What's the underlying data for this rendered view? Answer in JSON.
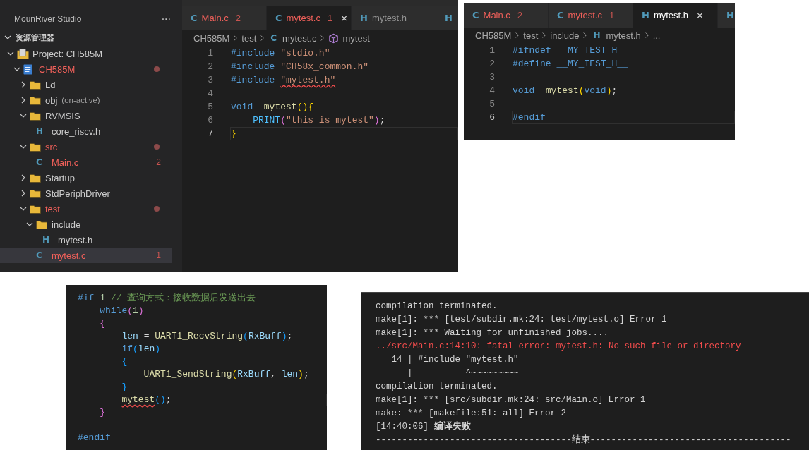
{
  "ide": {
    "sidebar": {
      "title": "MounRiver Studio",
      "more": "···",
      "section": "资源管理器",
      "tree": [
        {
          "label": "Project: CH585M",
          "kind": "project",
          "expanded": true,
          "error": false,
          "selected": false,
          "children": [
            {
              "label": "CH585M",
              "kind": "package",
              "expanded": true,
              "error": true,
              "dot": true,
              "selected": false,
              "children": [
                {
                  "label": "Ld",
                  "kind": "folder",
                  "expanded": false,
                  "error": false,
                  "selected": false
                },
                {
                  "label": "obj",
                  "note": "(on-active)",
                  "kind": "folder",
                  "expanded": false,
                  "error": false,
                  "selected": false
                },
                {
                  "label": "RVMSIS",
                  "kind": "folder",
                  "expanded": true,
                  "error": false,
                  "selected": false,
                  "children": [
                    {
                      "label": "core_riscv.h",
                      "kind": "file",
                      "letter": "H",
                      "error": false,
                      "selected": false
                    }
                  ]
                },
                {
                  "label": "src",
                  "kind": "folder",
                  "expanded": true,
                  "error": true,
                  "dot": true,
                  "selected": false,
                  "children": [
                    {
                      "label": "Main.c",
                      "kind": "file",
                      "letter": "C",
                      "badge": "2",
                      "error": true,
                      "selected": false
                    }
                  ]
                },
                {
                  "label": "Startup",
                  "kind": "folder",
                  "expanded": false,
                  "error": false,
                  "selected": false
                },
                {
                  "label": "StdPeriphDriver",
                  "kind": "folder",
                  "expanded": false,
                  "error": false,
                  "selected": false
                },
                {
                  "label": "test",
                  "kind": "folder",
                  "expanded": true,
                  "error": true,
                  "dot": true,
                  "selected": false,
                  "children": [
                    {
                      "label": "include",
                      "kind": "folder",
                      "expanded": true,
                      "error": false,
                      "selected": false,
                      "children": [
                        {
                          "label": "mytest.h",
                          "kind": "file",
                          "letter": "H",
                          "error": false,
                          "selected": false
                        }
                      ]
                    },
                    {
                      "label": "mytest.c",
                      "kind": "file",
                      "letter": "C",
                      "badge": "1",
                      "error": true,
                      "selected": true
                    }
                  ]
                }
              ]
            }
          ]
        }
      ]
    },
    "editor": {
      "tabs": [
        {
          "letter": "C",
          "label": "Main.c",
          "badge": "2",
          "error": true,
          "selected": false
        },
        {
          "letter": "C",
          "label": "mytest.c",
          "badge": "1",
          "error": true,
          "close": "×",
          "selected": true
        },
        {
          "letter": "H",
          "label": "mytest.h",
          "error": false,
          "selected": false
        },
        {
          "letter": "H",
          "selected": false
        }
      ],
      "breadcrumb": [
        {
          "text": "CH585M"
        },
        {
          "text": "test"
        },
        {
          "letter": "C",
          "text": "mytest.c"
        },
        {
          "kind": "symbol",
          "text": "mytest"
        }
      ],
      "lines": [
        {
          "number": "1",
          "current": false,
          "tokens": [
            {
              "t": "#include",
              "kind": "kw"
            },
            {
              "t": " \"stdio.h\"",
              "kind": "str"
            }
          ]
        },
        {
          "number": "2",
          "current": false,
          "tokens": [
            {
              "t": "#include",
              "kind": "kw"
            },
            {
              "t": " \"CH58x_common.h\"",
              "kind": "str"
            }
          ]
        },
        {
          "number": "3",
          "current": false,
          "tokens": [
            {
              "t": "#include",
              "kind": "kw"
            },
            {
              "t": " \"mytest.h\"",
              "kind": "str",
              "squiggle": true
            }
          ]
        },
        {
          "number": "4",
          "current": false
        },
        {
          "number": "5",
          "current": false,
          "tokens": [
            {
              "t": "void",
              "kind": "kw"
            },
            {
              "t": "  mytest",
              "kind": "fn"
            },
            {
              "t": "(){",
              "kind": "br1"
            }
          ]
        },
        {
          "number": "6",
          "current": false,
          "tokens": [
            {
              "t": "    PRINT",
              "kind": "macro"
            },
            {
              "t": "(",
              "kind": "br2"
            },
            {
              "t": "\"this is mytest\"",
              "kind": "str"
            },
            {
              "t": ")",
              "kind": "br2"
            },
            {
              "t": ";",
              "kind": "plain"
            }
          ]
        },
        {
          "number": "7",
          "current": true,
          "tokens": [
            {
              "t": "}",
              "kind": "br1"
            }
          ]
        }
      ]
    }
  },
  "header_window": {
    "editor": {
      "tabs": [
        {
          "letter": "C",
          "label": "Main.c",
          "badge": "2",
          "error": true,
          "selected": false
        },
        {
          "letter": "C",
          "label": "mytest.c",
          "badge": "1",
          "error": true,
          "selected": false
        },
        {
          "letter": "H",
          "label": "mytest.h",
          "error": false,
          "close": "×",
          "selected": true
        },
        {
          "letter": "H",
          "selected": false
        }
      ],
      "breadcrumb": [
        {
          "text": "CH585M"
        },
        {
          "text": "test"
        },
        {
          "text": "include"
        },
        {
          "letter": "H",
          "text": "mytest.h"
        },
        {
          "text": "..."
        }
      ],
      "lines": [
        {
          "number": "1",
          "current": false,
          "tokens": [
            {
              "t": "#ifndef",
              "kind": "kw"
            },
            {
              "t": " __MY_TEST_H__",
              "kind": "kw"
            }
          ]
        },
        {
          "number": "2",
          "current": false,
          "tokens": [
            {
              "t": "#define",
              "kind": "kw"
            },
            {
              "t": " __MY_TEST_H__",
              "kind": "kw"
            }
          ]
        },
        {
          "number": "3",
          "current": false
        },
        {
          "number": "4",
          "current": false,
          "tokens": [
            {
              "t": "void",
              "kind": "kw"
            },
            {
              "t": "  mytest",
              "kind": "fn"
            },
            {
              "t": "(",
              "kind": "br1"
            },
            {
              "t": "void",
              "kind": "kw"
            },
            {
              "t": ")",
              "kind": "br1"
            },
            {
              "t": ";",
              "kind": "plain"
            }
          ]
        },
        {
          "number": "5",
          "current": false
        },
        {
          "number": "6",
          "current": true,
          "tokens": [
            {
              "t": "#endif",
              "kind": "kw"
            }
          ]
        }
      ]
    }
  },
  "snippet": {
    "lines": [
      {
        "current": false,
        "tokens": [
          {
            "t": "#if",
            "kind": "kw"
          },
          {
            "t": " 1",
            "kind": "num"
          },
          {
            "t": " // 查询方式：接收数据后发送出去",
            "kind": "comment"
          }
        ]
      },
      {
        "current": false,
        "tokens": [
          {
            "t": "    while",
            "kind": "kw"
          },
          {
            "t": "(",
            "kind": "br2"
          },
          {
            "t": "1",
            "kind": "num"
          },
          {
            "t": ")",
            "kind": "br2"
          }
        ]
      },
      {
        "current": false,
        "tokens": [
          {
            "t": "    {",
            "kind": "br2"
          }
        ]
      },
      {
        "current": false,
        "tokens": [
          {
            "t": "        len",
            "kind": "var"
          },
          {
            "t": " = ",
            "kind": "plain"
          },
          {
            "t": "UART1_RecvString",
            "kind": "fn"
          },
          {
            "t": "(",
            "kind": "br3"
          },
          {
            "t": "RxBuff",
            "kind": "var"
          },
          {
            "t": ")",
            "kind": "br3"
          },
          {
            "t": ";",
            "kind": "plain"
          }
        ]
      },
      {
        "current": false,
        "tokens": [
          {
            "t": "        if",
            "kind": "kw"
          },
          {
            "t": "(",
            "kind": "br3"
          },
          {
            "t": "len",
            "kind": "var"
          },
          {
            "t": ")",
            "kind": "br3"
          }
        ]
      },
      {
        "current": false,
        "tokens": [
          {
            "t": "        {",
            "kind": "br3"
          }
        ]
      },
      {
        "current": false,
        "tokens": [
          {
            "t": "            UART1_SendString",
            "kind": "fn"
          },
          {
            "t": "(",
            "kind": "br1"
          },
          {
            "t": "RxBuff",
            "kind": "var"
          },
          {
            "t": ",",
            "kind": "plain"
          },
          {
            "t": " len",
            "kind": "var"
          },
          {
            "t": ")",
            "kind": "br1"
          },
          {
            "t": ";",
            "kind": "plain"
          }
        ]
      },
      {
        "current": false,
        "tokens": [
          {
            "t": "        }",
            "kind": "br3"
          }
        ]
      },
      {
        "current": true,
        "tokens": [
          {
            "t": "        mytest",
            "kind": "fn",
            "squiggle": true
          },
          {
            "t": "()",
            "kind": "br3"
          },
          {
            "t": ";",
            "kind": "plain"
          }
        ]
      },
      {
        "current": false,
        "tokens": [
          {
            "t": "    }",
            "kind": "br2"
          }
        ]
      },
      {
        "current": false
      },
      {
        "current": false,
        "tokens": [
          {
            "t": "#endif",
            "kind": "kw"
          }
        ]
      }
    ]
  },
  "terminal": {
    "lines": [
      {
        "kind": "normal",
        "text": "compilation terminated."
      },
      {
        "kind": "normal",
        "text": "make[1]: *** [test/subdir.mk:24: test/mytest.o] Error 1"
      },
      {
        "kind": "normal",
        "text": "make[1]: *** Waiting for unfinished jobs...."
      },
      {
        "kind": "error",
        "text": "../src/Main.c:14:10: fatal error: mytest.h: No such file or directory"
      },
      {
        "kind": "normal",
        "text": "   14 | #include \"mytest.h\""
      },
      {
        "kind": "normal",
        "text": "      |          ^~~~~~~~~~"
      },
      {
        "kind": "normal",
        "text": "compilation terminated."
      },
      {
        "kind": "normal",
        "text": "make[1]: *** [src/subdir.mk:24: src/Main.o] Error 1"
      },
      {
        "kind": "normal",
        "text": "make: *** [makefile:51: all] Error 2"
      },
      {
        "kind": "normal",
        "text": "[14:40:06] **编译失败**"
      },
      {
        "kind": "normal",
        "text": "-------------------------------------结束--------------------------------------"
      }
    ]
  }
}
